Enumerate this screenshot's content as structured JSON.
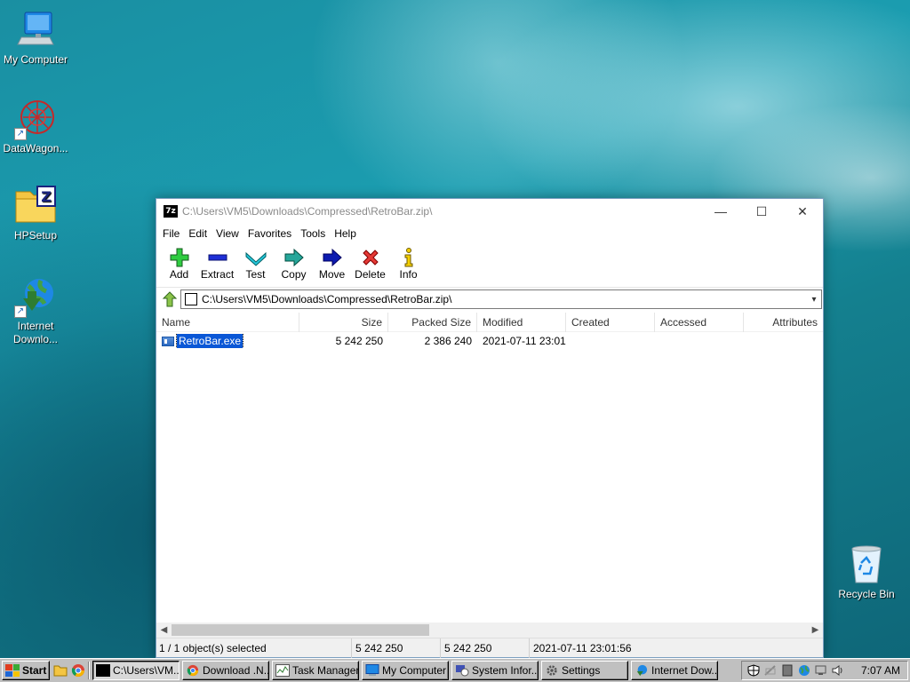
{
  "desktop": {
    "icons": [
      {
        "label": "My Computer"
      },
      {
        "label": "DataWagon..."
      },
      {
        "label": "HPSetup"
      },
      {
        "label": "Internet Downlo..."
      },
      {
        "label": "Recycle Bin"
      }
    ]
  },
  "window": {
    "title": "C:\\Users\\VM5\\Downloads\\Compressed\\RetroBar.zip\\",
    "app_icon_text": "7z",
    "controls": {
      "minimize": "—",
      "maximize": "☐",
      "close": "✕"
    },
    "menu": [
      "File",
      "Edit",
      "View",
      "Favorites",
      "Tools",
      "Help"
    ],
    "toolbar": {
      "add": "Add",
      "extract": "Extract",
      "test": "Test",
      "copy": "Copy",
      "move": "Move",
      "delete": "Delete",
      "info": "Info"
    },
    "address": {
      "path": "C:\\Users\\VM5\\Downloads\\Compressed\\RetroBar.zip\\"
    },
    "columns": [
      "Name",
      "Size",
      "Packed Size",
      "Modified",
      "Created",
      "Accessed",
      "Attributes"
    ],
    "rows": [
      {
        "name": "RetroBar.exe",
        "size": "5 242 250",
        "packed_size": "2 386 240",
        "modified": "2021-07-11 23:01",
        "created": "",
        "accessed": "",
        "attributes": ""
      }
    ],
    "status": {
      "selection": "1 / 1 object(s) selected",
      "size": "5 242 250",
      "packed": "5 242 250",
      "modified": "2021-07-11 23:01:56"
    }
  },
  "taskbar": {
    "start_label": "Start",
    "tasks": [
      {
        "label": "C:\\Users\\VM..."
      },
      {
        "label": "Download .N..."
      },
      {
        "label": "Task Manager"
      },
      {
        "label": "My Computer"
      },
      {
        "label": "System Infor..."
      },
      {
        "label": "Settings"
      },
      {
        "label": "Internet Dow..."
      }
    ],
    "clock": "7:07 AM"
  }
}
